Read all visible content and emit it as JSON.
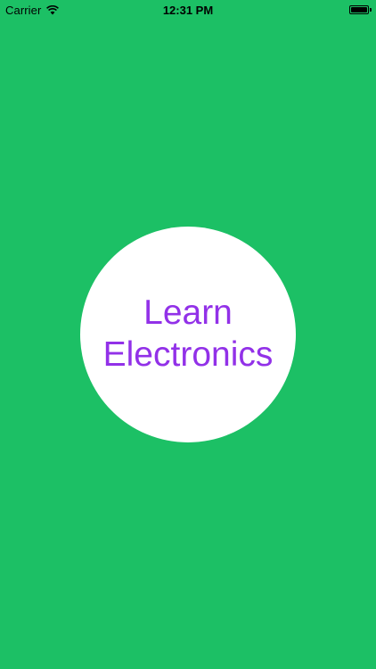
{
  "status_bar": {
    "carrier": "Carrier",
    "time": "12:31 PM",
    "wifi_icon": "wifi-icon",
    "battery_icon": "battery-icon",
    "battery_level": 1.0
  },
  "splash": {
    "title_line1": "Learn",
    "title_line2": "Electronics",
    "background_color": "#1CC065",
    "circle_color": "#FFFFFF",
    "text_color": "#9231E8"
  }
}
